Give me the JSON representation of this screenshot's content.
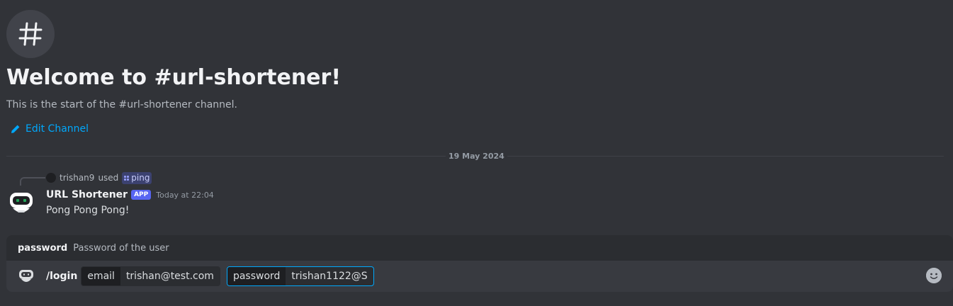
{
  "channel_header": {
    "icon": "hashtag-icon",
    "title": "Welcome to #url-shortener!",
    "subtitle": "This is the start of the #url-shortener channel.",
    "edit_label": "Edit Channel"
  },
  "divider": {
    "date": "19 May 2024"
  },
  "message": {
    "reply": {
      "user": "trishan9",
      "used_text": "used",
      "command": "ping"
    },
    "author": "URL Shortener",
    "badge": "APP",
    "timestamp": "Today at 22:04",
    "content": "Pong Pong Pong!"
  },
  "composer": {
    "option_hint": {
      "name": "password",
      "description": "Password of the user"
    },
    "command": "/login",
    "fields": [
      {
        "label": "email",
        "value": "trishan@test.com"
      },
      {
        "label": "password",
        "value": "trishan1122@S"
      }
    ]
  },
  "colors": {
    "background": "#313338",
    "link": "#00a8fc",
    "app_badge": "#5865f2"
  }
}
